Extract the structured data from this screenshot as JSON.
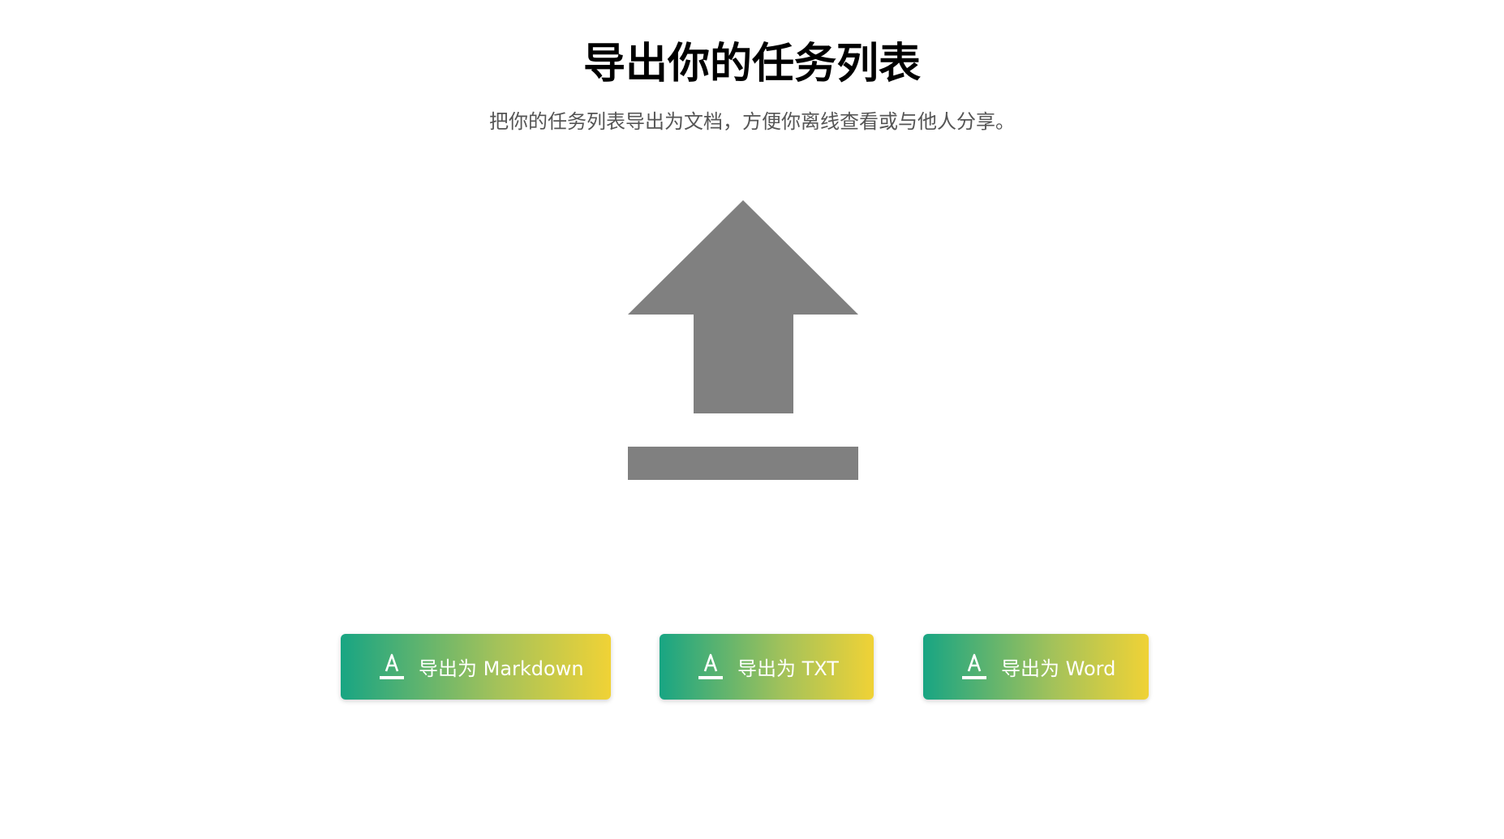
{
  "header": {
    "title": "导出你的任务列表",
    "subtitle": "把你的任务列表导出为文档，方便你离线查看或与他人分享。"
  },
  "illustration": {
    "icon": "upload-icon",
    "color": "#808080"
  },
  "export_buttons": [
    {
      "label": "导出为 Markdown",
      "icon": "text-format-icon"
    },
    {
      "label": "导出为 TXT",
      "icon": "text-format-icon"
    },
    {
      "label": "导出为 Word",
      "icon": "text-format-icon"
    }
  ],
  "colors": {
    "gradient_start": "#18a583",
    "gradient_end": "#f0d236",
    "subtitle_text": "#555555"
  }
}
